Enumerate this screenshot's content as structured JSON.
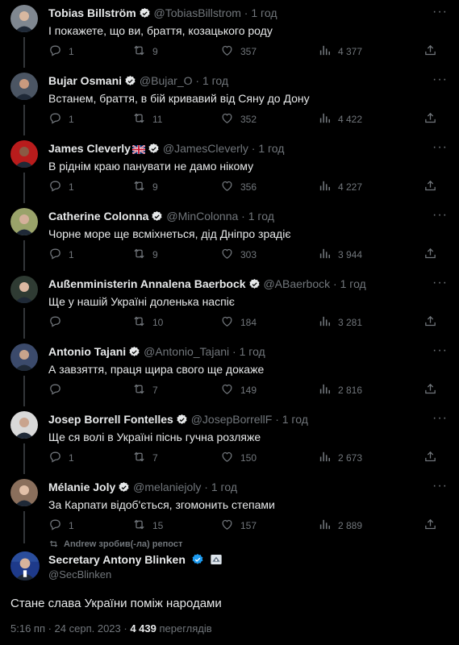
{
  "tweets": [
    {
      "name": "Tobias Billström",
      "handle": "@TobiasBillstrom",
      "sep": "·",
      "time": "1 год",
      "text": "І покажете, що ви, браття, козацького роду",
      "replies": "1",
      "retweets": "9",
      "likes": "357",
      "views": "4 377",
      "avatar_color": "#7f8790",
      "face_color": "#d8b8a0"
    },
    {
      "name": "Bujar Osmani",
      "handle": "@Bujar_O",
      "sep": "·",
      "time": "1 год",
      "text": "Встанем, браття, в бій кривавий від Сяну до Дону",
      "replies": "1",
      "retweets": "11",
      "likes": "352",
      "views": "4 422",
      "avatar_color": "#4b5563",
      "face_color": "#c99a7e"
    },
    {
      "name": "James Cleverly",
      "handle": "@JamesCleverly",
      "sep": "·",
      "time": "1 год",
      "text": "В ріднім краю панувати не дамо нікому",
      "replies": "1",
      "retweets": "9",
      "likes": "356",
      "views": "4 227",
      "avatar_color": "#b91c1c",
      "face_color": "#8a5a44"
    },
    {
      "name": "Catherine Colonna",
      "handle": "@MinColonna",
      "sep": "·",
      "time": "1 год",
      "text": "Чорне море ще всміхнеться, дід Дніпро зрадіє",
      "replies": "1",
      "retweets": "9",
      "likes": "303",
      "views": "3 944",
      "avatar_color": "#9aa36a",
      "face_color": "#d4b09a"
    },
    {
      "name": "Außenministerin Annalena Baerbock",
      "handle": "@ABaerbock",
      "sep": "·",
      "time": "1 год",
      "text": "Ще у нашій Україні доленька наспіє",
      "replies": "",
      "retweets": "10",
      "likes": "184",
      "views": "3 281",
      "avatar_color": "#2f3b33",
      "face_color": "#dcb8a2"
    },
    {
      "name": "Antonio Tajani",
      "handle": "@Antonio_Tajani",
      "sep": "·",
      "time": "1 год",
      "text": "А завзяття, праця щира свого ще докаже",
      "replies": "",
      "retweets": "7",
      "likes": "149",
      "views": "2 816",
      "avatar_color": "#3b4a6b",
      "face_color": "#c8a48c"
    },
    {
      "name": "Josep Borrell Fontelles",
      "handle": "@JosepBorrellF",
      "sep": "·",
      "time": "1 год",
      "text": "Ще ся волі в Україні піснь гучна розляже",
      "replies": "1",
      "retweets": "7",
      "likes": "150",
      "views": "2 673",
      "avatar_color": "#d9d9d9",
      "face_color": "#c9a48e"
    },
    {
      "name": "Mélanie Joly",
      "handle": "@melaniejoly",
      "sep": "·",
      "time": "1 год",
      "text": "За Карпати відоб'ється, згомонить степами",
      "replies": "1",
      "retweets": "15",
      "likes": "157",
      "views": "2 889",
      "avatar_color": "#8a6f5c",
      "face_color": "#e2c0a8"
    }
  ],
  "repost": {
    "text": "Andrew зробив(-ла) репост"
  },
  "main": {
    "name": "Secretary Antony Blinken",
    "handle": "@SecBlinken",
    "text": "Стане слава України поміж народами",
    "time": "5:16 пп · 24 серп. 2023 ·",
    "views": "4 439",
    "views_label": "переглядів",
    "avatar_color": "#1e3a8a",
    "face_color": "#d8b49c"
  },
  "icons": {
    "more": "more-icon",
    "verified": "verified-badge-icon",
    "reply": "reply-icon",
    "retweet": "retweet-icon",
    "like": "heart-icon",
    "views": "views-chart-icon",
    "share": "share-icon",
    "flag": "uk-flag-icon",
    "gov": "government-badge-icon"
  },
  "colors": {
    "background": "#000000",
    "text": "#e7e9ea",
    "muted": "#71767b",
    "verified": "#1d9bf0"
  }
}
